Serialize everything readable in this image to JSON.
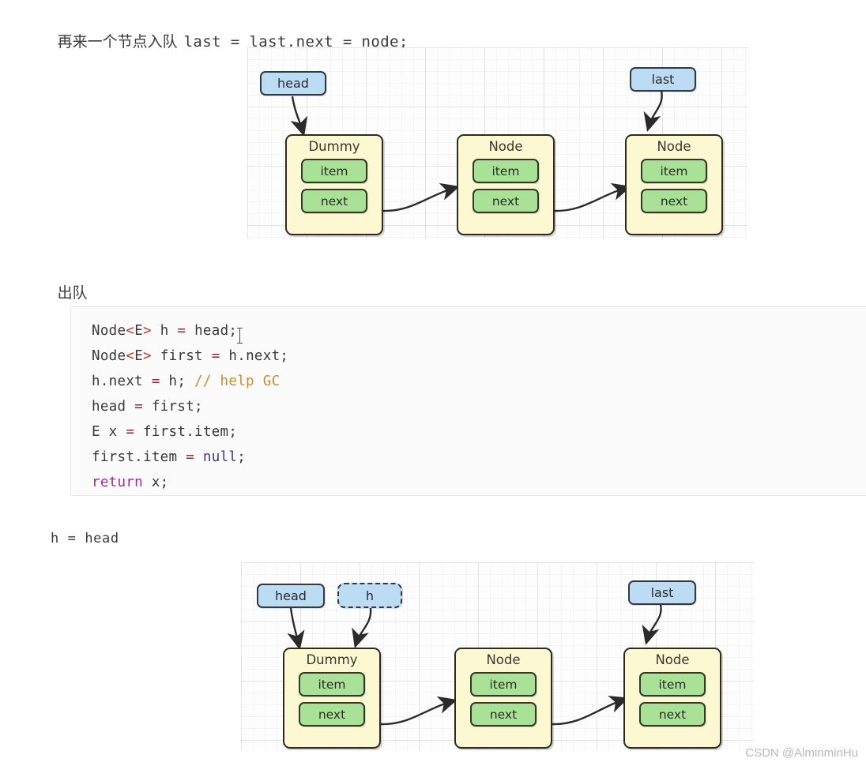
{
  "sections": {
    "heading1_cjk": "再来一个节点入队",
    "heading1_code": "last = last.next = node;",
    "heading2": "出队",
    "caption_h_head": "h = head"
  },
  "code_block": {
    "lines": [
      [
        {
          "t": "Node",
          "c": "id"
        },
        {
          "t": "<",
          "c": "gen"
        },
        {
          "t": "E",
          "c": "id"
        },
        {
          "t": ">",
          "c": "gen"
        },
        {
          "t": " h ",
          "c": "id"
        },
        {
          "t": "=",
          "c": "op"
        },
        {
          "t": " head;",
          "c": "id"
        }
      ],
      [
        {
          "t": "Node",
          "c": "id"
        },
        {
          "t": "<",
          "c": "gen"
        },
        {
          "t": "E",
          "c": "id"
        },
        {
          "t": ">",
          "c": "gen"
        },
        {
          "t": " first ",
          "c": "id"
        },
        {
          "t": "=",
          "c": "op"
        },
        {
          "t": " h.next;",
          "c": "id"
        }
      ],
      [
        {
          "t": "h.next ",
          "c": "id"
        },
        {
          "t": "=",
          "c": "op"
        },
        {
          "t": " h; ",
          "c": "id"
        },
        {
          "t": "// help GC",
          "c": "cmt"
        }
      ],
      [
        {
          "t": "head ",
          "c": "id"
        },
        {
          "t": "=",
          "c": "op"
        },
        {
          "t": " first;",
          "c": "id"
        }
      ],
      [
        {
          "t": "E x ",
          "c": "id"
        },
        {
          "t": "=",
          "c": "op"
        },
        {
          "t": " first.item;",
          "c": "id"
        }
      ],
      [
        {
          "t": "first.item ",
          "c": "id"
        },
        {
          "t": "=",
          "c": "op"
        },
        {
          "t": " ",
          "c": "id"
        },
        {
          "t": "null",
          "c": "lit"
        },
        {
          "t": ";",
          "c": "id"
        }
      ],
      [
        {
          "t": "return",
          "c": "kw"
        },
        {
          "t": " x;",
          "c": "id"
        }
      ]
    ]
  },
  "diagram1": {
    "pointers": [
      {
        "label": "head"
      },
      {
        "label": "last"
      }
    ],
    "nodes": [
      {
        "title": "Dummy",
        "fields": [
          "item",
          "next"
        ]
      },
      {
        "title": "Node",
        "fields": [
          "item",
          "next"
        ]
      },
      {
        "title": "Node",
        "fields": [
          "item",
          "next"
        ]
      }
    ]
  },
  "diagram2": {
    "pointers": [
      {
        "label": "head",
        "style": "solid"
      },
      {
        "label": "h",
        "style": "dashed"
      },
      {
        "label": "last",
        "style": "solid"
      }
    ],
    "nodes": [
      {
        "title": "Dummy",
        "fields": [
          "item",
          "next"
        ]
      },
      {
        "title": "Node",
        "fields": [
          "item",
          "next"
        ]
      },
      {
        "title": "Node",
        "fields": [
          "item",
          "next"
        ]
      }
    ]
  },
  "watermark": "CSDN @AlminminHu",
  "colors": {
    "pointer_fill": "#bcdcf4",
    "node_fill": "#fcf8d2",
    "field_fill": "#a9e296",
    "stroke": "#2e2a22",
    "code_keyword": "#a626a4",
    "code_literal": "#3b35a8",
    "code_comment": "#d08b26",
    "code_generic": "#c0392b"
  }
}
